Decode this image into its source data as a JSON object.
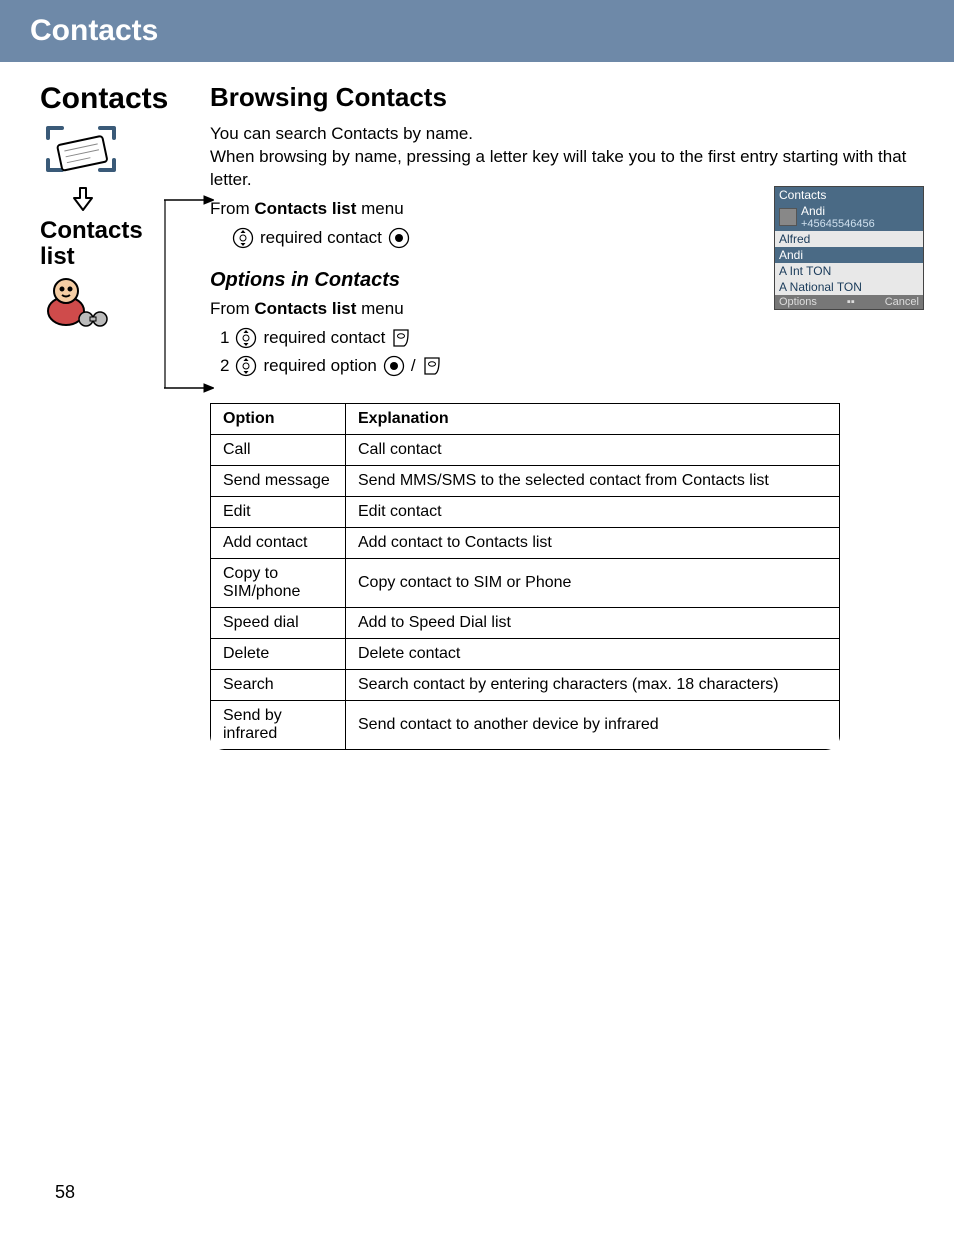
{
  "header": {
    "title": "Contacts"
  },
  "sidebar": {
    "title": "Contacts",
    "subtitle_line1": "Contacts",
    "subtitle_line2": "list"
  },
  "main": {
    "h2": "Browsing Contacts",
    "intro1": "You can search Contacts by name.",
    "intro2": "When browsing by name, pressing a letter key will take you to the first entry starting with that letter.",
    "from_prefix": "From ",
    "from_bold": "Contacts list",
    "from_suffix": " menu",
    "step_text": "required contact",
    "sub_h": "Options in Contacts",
    "sub_from_prefix": "From ",
    "sub_from_bold": "Contacts list",
    "sub_from_suffix": " menu",
    "step1_num": "1",
    "step1_text": "required contact",
    "step2_num": "2",
    "step2_text": "required option",
    "slash": " / "
  },
  "table": {
    "head_option": "Option",
    "head_expl": "Explanation",
    "rows": [
      {
        "opt": "Call",
        "exp": "Call contact"
      },
      {
        "opt": "Send message",
        "exp": "Send MMS/SMS to the selected contact from Contacts list"
      },
      {
        "opt": "Edit",
        "exp": "Edit contact"
      },
      {
        "opt": "Add contact",
        "exp": "Add contact to Contacts list"
      },
      {
        "opt": "Copy to SIM/phone",
        "exp": "Copy contact to SIM or Phone"
      },
      {
        "opt": "Speed dial",
        "exp": "Add to Speed Dial list"
      },
      {
        "opt": "Delete",
        "exp": "Delete contact"
      },
      {
        "opt": "Search",
        "exp": "Search contact by entering characters (max. 18 characters)"
      },
      {
        "opt": "Send by infrared",
        "exp": "Send contact to another device by infrared"
      }
    ]
  },
  "phone": {
    "title": "Contacts",
    "entries": [
      {
        "name": "Andi",
        "sub": "+45645546456",
        "sel": true,
        "thumb": true
      },
      {
        "name": "Alfred"
      },
      {
        "name": "Andi",
        "sel": true
      },
      {
        "name": "A Int TON"
      },
      {
        "name": "A National TON"
      }
    ],
    "left": "Options",
    "mid": "▪▪",
    "right": "Cancel"
  },
  "page_number": "58"
}
